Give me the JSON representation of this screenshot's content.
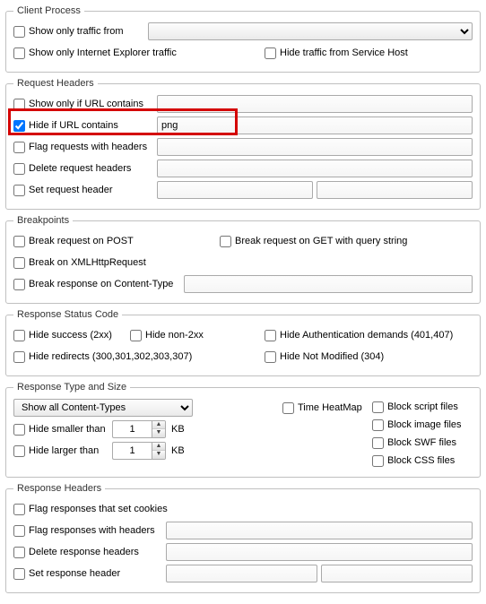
{
  "client_process": {
    "legend": "Client Process",
    "show_only_from": "Show only traffic from",
    "show_only_ie": "Show only Internet Explorer traffic",
    "hide_service_host": "Hide traffic from Service Host",
    "combo_value": ""
  },
  "request_headers": {
    "legend": "Request Headers",
    "show_only_url": "Show only if URL contains",
    "hide_if_url": "Hide if URL contains",
    "hide_if_url_value": "png",
    "flag_with_headers": "Flag requests with headers",
    "delete_headers": "Delete request headers",
    "set_header": "Set request header"
  },
  "breakpoints": {
    "legend": "Breakpoints",
    "on_post": "Break request on POST",
    "on_get_query": "Break request on GET with query string",
    "on_xhr": "Break on XMLHttpRequest",
    "on_content_type": "Break response on Content-Type"
  },
  "status_code": {
    "legend": "Response Status Code",
    "hide_success": "Hide success (2xx)",
    "hide_non2xx": "Hide non-2xx",
    "hide_auth": "Hide Authentication demands (401,407)",
    "hide_redirects": "Hide redirects (300,301,302,303,307)",
    "hide_not_modified": "Hide Not Modified (304)"
  },
  "type_size": {
    "legend": "Response Type and Size",
    "content_types": "Show all Content-Types",
    "time_heatmap": "Time HeatMap",
    "block_script": "Block script files",
    "block_image": "Block image files",
    "block_swf": "Block SWF files",
    "block_css": "Block CSS files",
    "hide_smaller": "Hide smaller than",
    "hide_larger": "Hide larger than",
    "smaller_value": "1",
    "larger_value": "1",
    "unit": "KB"
  },
  "response_headers": {
    "legend": "Response Headers",
    "flag_cookies": "Flag responses that set cookies",
    "flag_with_headers": "Flag responses with headers",
    "delete_headers": "Delete response headers",
    "set_header": "Set response header"
  }
}
